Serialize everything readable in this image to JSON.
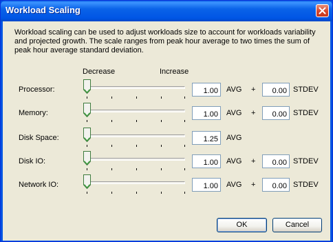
{
  "window": {
    "title": "Workload Scaling"
  },
  "description": "Workload scaling can be used to adjust workloads size to account for workloads variability and projected growth.  The scale ranges from peak hour average to two times the sum of peak hour average standard deviation.",
  "scale_headers": {
    "decrease": "Decrease",
    "increase": "Increase"
  },
  "rows": [
    {
      "label": "Processor:",
      "avg": "1.00",
      "avg_unit": "AVG",
      "plus": "+",
      "stdev": "0.00",
      "stdev_unit": "STDEV",
      "slider_level": 0
    },
    {
      "label": "Memory:",
      "avg": "1.00",
      "avg_unit": "AVG",
      "plus": "+",
      "stdev": "0.00",
      "stdev_unit": "STDEV",
      "slider_level": 0
    },
    {
      "label": "Disk Space:",
      "avg": "1.25",
      "avg_unit": "AVG",
      "slider_level": 0
    },
    {
      "label": "Disk IO:",
      "avg": "1.00",
      "avg_unit": "AVG",
      "plus": "+",
      "stdev": "0.00",
      "stdev_unit": "STDEV",
      "slider_level": 0
    },
    {
      "label": "Network IO:",
      "avg": "1.00",
      "avg_unit": "AVG",
      "plus": "+",
      "stdev": "0.00",
      "stdev_unit": "STDEV",
      "slider_level": 0
    }
  ],
  "buttons": {
    "ok": "OK",
    "cancel": "Cancel"
  },
  "colors": {
    "titlebar": "#0054e3",
    "dialog_bg": "#ece9d8",
    "close_button": "#d6452a",
    "field_border": "#7f9db9"
  }
}
